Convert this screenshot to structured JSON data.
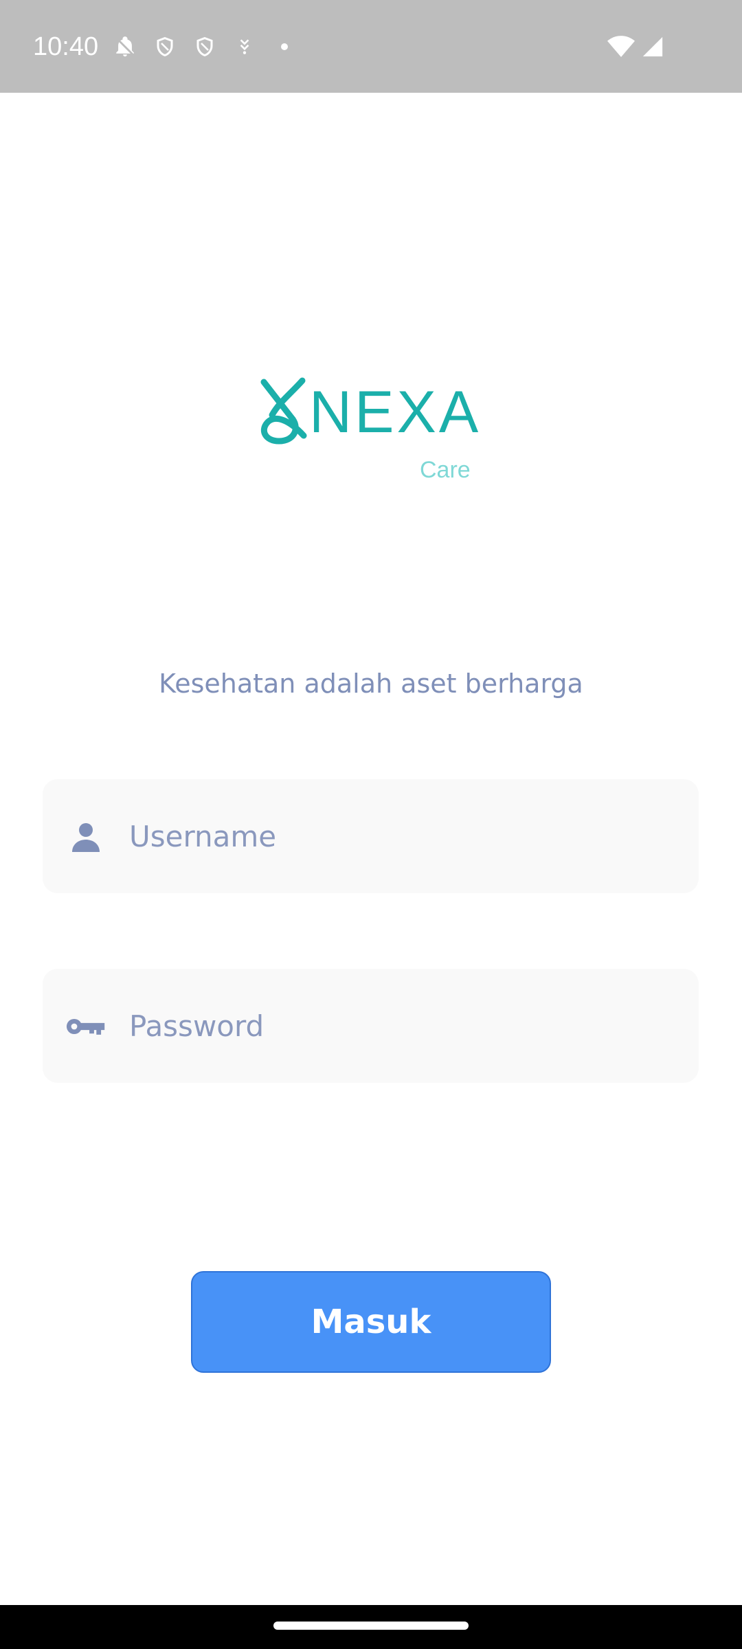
{
  "status_bar": {
    "time": "10:40",
    "left_icons": [
      "alarm-icon",
      "shield-icon",
      "shield-icon",
      "download-icon",
      "dot-icon"
    ],
    "right_icons": [
      "wifi-icon",
      "signal-icon"
    ]
  },
  "logo": {
    "wordmark": "NEXA",
    "subtitle": "Care",
    "color": "#1bafaa"
  },
  "tagline": "Kesehatan adalah aset berharga",
  "form": {
    "username_placeholder": "Username",
    "password_placeholder": "Password",
    "username_icon": "person-icon",
    "password_icon": "key-icon"
  },
  "login_button": {
    "label": "Masuk",
    "color": "#4892f7"
  },
  "colors": {
    "status_bar": "#bdbdbd",
    "text_muted": "#7f8fb8",
    "field_background": "#f9f9f9"
  }
}
